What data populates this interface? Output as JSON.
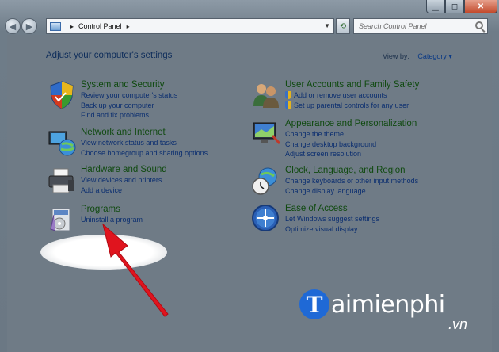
{
  "address_bar": {
    "breadcrumb": "Control Panel",
    "search_placeholder": "Search Control Panel"
  },
  "header": {
    "title": "Adjust your computer's settings",
    "view_by_label": "View by:",
    "view_by_value": "Category ▾"
  },
  "categories_left": [
    {
      "title": "System and Security",
      "icon": "system-security-icon",
      "links": [
        "Review your computer's status",
        "Back up your computer",
        "Find and fix problems"
      ]
    },
    {
      "title": "Network and Internet",
      "icon": "network-globe-icon",
      "links": [
        "View network status and tasks",
        "Choose homegroup and sharing options"
      ]
    },
    {
      "title": "Hardware and Sound",
      "icon": "printer-icon",
      "links": [
        "View devices and printers",
        "Add a device"
      ]
    },
    {
      "title": "Programs",
      "icon": "programs-icon",
      "links": [
        "Uninstall a program"
      ]
    }
  ],
  "categories_right": [
    {
      "title": "User Accounts and Family Safety",
      "icon": "users-icon",
      "links": [
        "Add or remove user accounts",
        "Set up parental controls for any user"
      ],
      "shield_links": [
        true,
        true
      ]
    },
    {
      "title": "Appearance and Personalization",
      "icon": "monitor-icon",
      "links": [
        "Change the theme",
        "Change desktop background",
        "Adjust screen resolution"
      ]
    },
    {
      "title": "Clock, Language, and Region",
      "icon": "clock-globe-icon",
      "links": [
        "Change keyboards or other input methods",
        "Change display language"
      ]
    },
    {
      "title": "Ease of Access",
      "icon": "ease-of-access-icon",
      "links": [
        "Let Windows suggest settings",
        "Optimize visual display"
      ]
    }
  ],
  "watermark": {
    "logo_letter": "T",
    "text": "aimienphi",
    "suffix": ".vn"
  },
  "colors": {
    "link": "#0c2f70",
    "category_title": "#104a10",
    "annotation_arrow": "#e0141e"
  }
}
